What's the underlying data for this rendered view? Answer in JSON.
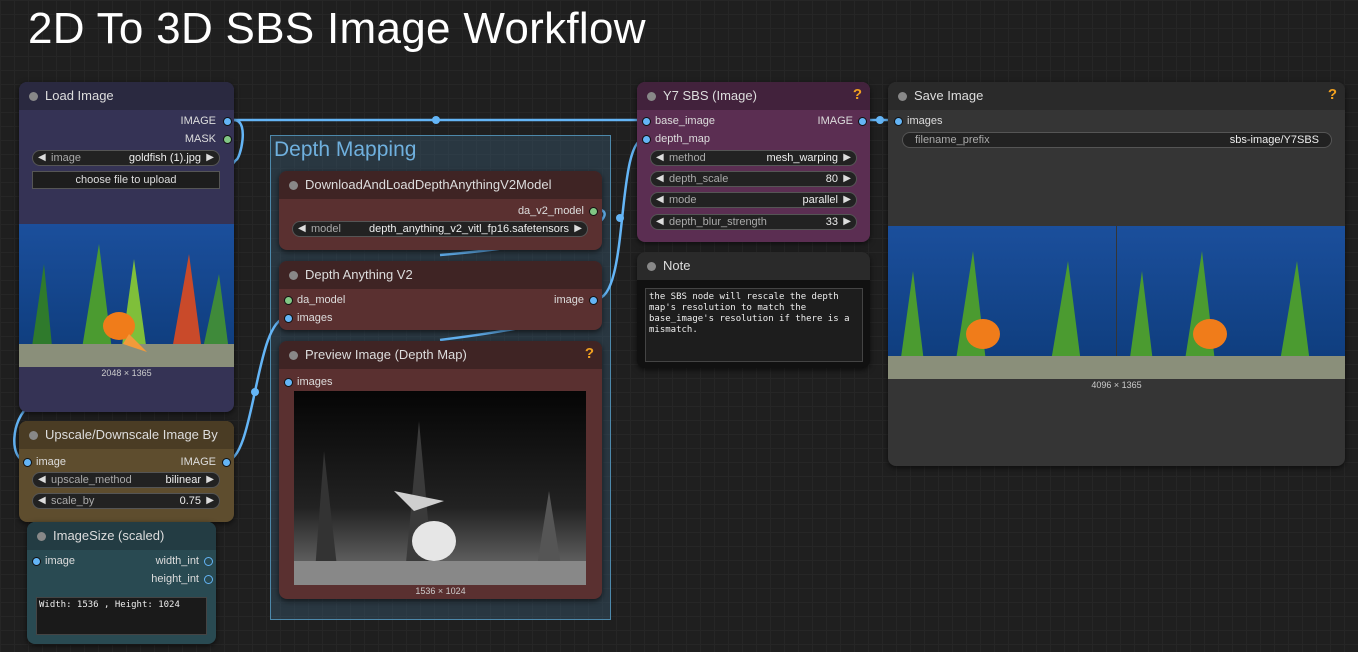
{
  "page_title": "2D To 3D SBS Image Workflow",
  "colors": {
    "link": "#64b5f6",
    "image_slot": "#64b5f6",
    "mask_slot": "#81c784",
    "model_slot": "#b2dfdb",
    "help": "#f0a020"
  },
  "group": {
    "title": "Depth Mapping"
  },
  "load_image": {
    "title": "Load Image",
    "outputs": [
      "IMAGE",
      "MASK"
    ],
    "image_label": "image",
    "image_value": "goldfish (1).jpg",
    "upload_label": "choose file to upload",
    "caption": "2048 × 1365"
  },
  "upscale": {
    "title": "Upscale/Downscale Image By",
    "input": "image",
    "output": "IMAGE",
    "method_label": "upscale_method",
    "method_value": "bilinear",
    "scale_label": "scale_by",
    "scale_value": "0.75"
  },
  "imagesize": {
    "title": "ImageSize (scaled)",
    "input": "image",
    "out1": "width_int",
    "out2": "height_int",
    "text": "Width: 1536 , Height: 1024"
  },
  "da_loader": {
    "title": "DownloadAndLoadDepthAnythingV2Model",
    "output": "da_v2_model",
    "model_label": "model",
    "model_value": "depth_anything_v2_vitl_fp16.safetensors"
  },
  "depth_anything": {
    "title": "Depth Anything V2",
    "in1": "da_model",
    "in2": "images",
    "output": "image"
  },
  "preview": {
    "title": "Preview Image (Depth Map)",
    "input": "images",
    "caption": "1536 × 1024",
    "help": "?"
  },
  "sbs": {
    "title": "Y7 SBS (Image)",
    "in1": "base_image",
    "in2": "depth_map",
    "output": "IMAGE",
    "widgets": [
      {
        "label": "method",
        "value": "mesh_warping"
      },
      {
        "label": "depth_scale",
        "value": "80"
      },
      {
        "label": "mode",
        "value": "parallel"
      },
      {
        "label": "depth_blur_strength",
        "value": "33"
      }
    ],
    "help": "?"
  },
  "note": {
    "title": "Note",
    "text": "the SBS node will rescale the depth\nmap's resolution to match the\nbase_image's resolution if there is a\nmismatch."
  },
  "save": {
    "title": "Save Image",
    "input": "images",
    "prefix_label": "filename_prefix",
    "prefix_value": "sbs-image/Y7SBS",
    "caption": "4096 × 1365",
    "help": "?"
  }
}
